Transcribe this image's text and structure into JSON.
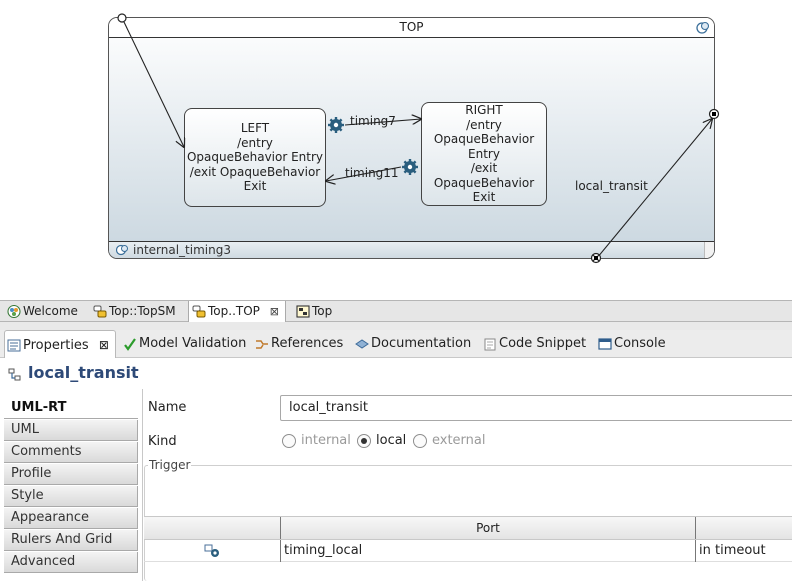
{
  "diagram": {
    "top_state": {
      "title": "TOP",
      "region_label": "internal_timing3"
    },
    "states": {
      "left": {
        "text": "LEFT\n/entry\nOpaqueBehavior Entry\n/exit OpaqueBehavior\nExit"
      },
      "right": {
        "text": "RIGHT\n/entry\nOpaqueBehavior\nEntry\n/exit\nOpaqueBehavior\nExit"
      }
    },
    "transitions": {
      "timing7": "timing7",
      "timing11": "timing11",
      "local_transit": "local_transit"
    }
  },
  "editor_tabs": [
    {
      "label": "Welcome",
      "icon": "papyrus-welcome-icon"
    },
    {
      "label": "Top::TopSM",
      "icon": "state-machine-icon"
    },
    {
      "label": "Top..TOP",
      "icon": "state-machine-icon",
      "active": true,
      "close": "⊠"
    },
    {
      "label": "Top",
      "icon": "capsule-structure-icon"
    }
  ],
  "view_tabs": [
    {
      "label": "Properties",
      "icon": "properties-icon",
      "active": true,
      "close": "⊠"
    },
    {
      "label": "Model Validation",
      "icon": "check-icon"
    },
    {
      "label": "References",
      "icon": "references-icon"
    },
    {
      "label": "Documentation",
      "icon": "documentation-icon"
    },
    {
      "label": "Code Snippet",
      "icon": "code-snippet-icon"
    },
    {
      "label": "Console",
      "icon": "console-icon"
    }
  ],
  "properties": {
    "title": "local_transit",
    "side_tabs": [
      "UML-RT",
      "UML",
      "Comments",
      "Profile",
      "Style",
      "Appearance",
      "Rulers And Grid",
      "Advanced"
    ],
    "active_side_tab": "UML-RT",
    "name_label": "Name",
    "name_value": "local_transit",
    "kind_label": "Kind",
    "kind_options": [
      {
        "label": "internal",
        "checked": false,
        "disabled": true
      },
      {
        "label": "local",
        "checked": true,
        "disabled": false
      },
      {
        "label": "external",
        "checked": false,
        "disabled": true
      }
    ],
    "trigger_label": "Trigger",
    "trigger_table": {
      "headers": [
        "",
        "Port",
        ""
      ],
      "rows": [
        {
          "icon": "trigger-icon",
          "port": "timing_local",
          "event": "in timeout"
        }
      ]
    }
  },
  "colors": {
    "title_blue": "#2e4a78",
    "gear_blue": "#2a5e7e",
    "state_gradient_bottom": "#c9d6df"
  }
}
